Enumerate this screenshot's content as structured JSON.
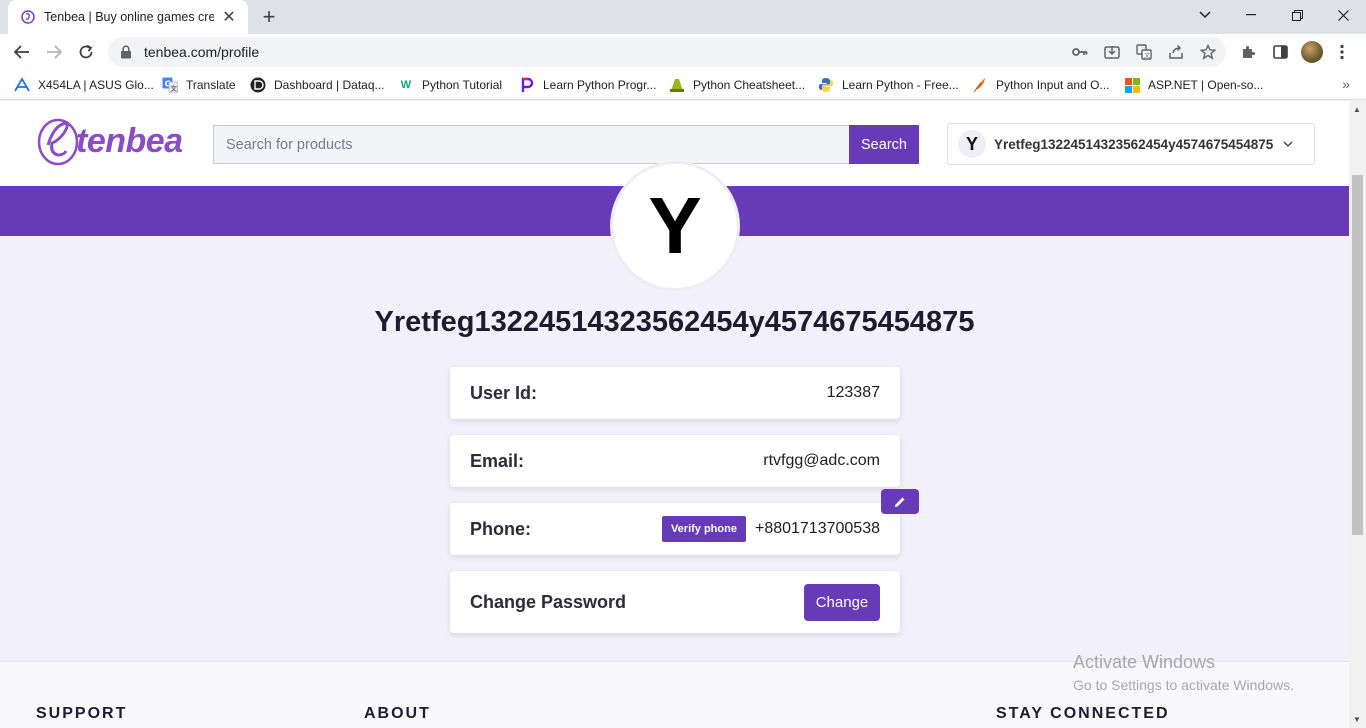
{
  "browser": {
    "tab_title": "Tenbea | Buy online games credit",
    "url": "tenbea.com/profile",
    "bookmarks": [
      {
        "label": "X454LA | ASUS Glo...",
        "icon": "asus-icon",
        "color": "#1a73e8"
      },
      {
        "label": "Translate",
        "icon": "translate-icon",
        "color": "#4285f4"
      },
      {
        "label": "Dashboard | Dataq...",
        "icon": "dataquest-icon",
        "color": "#222222"
      },
      {
        "label": "Python Tutorial",
        "icon": "w3schools-icon",
        "color": "#04aa6d"
      },
      {
        "label": "Learn Python Progr...",
        "icon": "programiz-icon",
        "color": "#6a1bd6"
      },
      {
        "label": "Python Cheatsheet...",
        "icon": "cheatsheet-icon",
        "color": "#9ab51e"
      },
      {
        "label": "Learn Python - Free...",
        "icon": "python-icon",
        "color": "#3776ab"
      },
      {
        "label": "Python Input and O...",
        "icon": "feather-icon",
        "color": "#e07b20"
      },
      {
        "label": "ASP.NET | Open-so...",
        "icon": "microsoft-icon",
        "color": "#f25022"
      }
    ]
  },
  "header": {
    "logo_text": "tenbea",
    "search_placeholder": "Search for products",
    "search_button": "Search",
    "account_initial": "Y",
    "account_name": "Yretfeg13224514323562454y4574675454875"
  },
  "profile": {
    "avatar_initial": "Y",
    "name": "Yretfeg13224514323562454y4574675454875",
    "user_id_label": "User Id:",
    "user_id_value": "123387",
    "email_label": "Email:",
    "email_value": "rtvfgg@adc.com",
    "phone_label": "Phone:",
    "verify_button": "Verify phone",
    "phone_value": "+8801713700538",
    "password_label": "Change Password",
    "change_button": "Change"
  },
  "footer": {
    "support": "SUPPORT",
    "about": "ABOUT",
    "stay_connected": "STAY CONNECTED"
  },
  "watermark": {
    "line1": "Activate Windows",
    "line2": "Go to Settings to activate Windows."
  },
  "colors": {
    "brand": "#673ab7",
    "page_bg": "#f2f0fb"
  }
}
